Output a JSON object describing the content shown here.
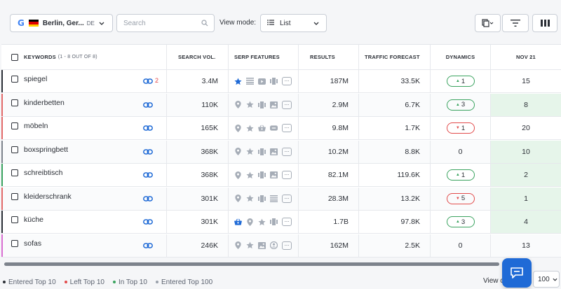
{
  "toolbar": {
    "location": "Berlin, Ger...",
    "location_code": "DE",
    "search_placeholder": "Search",
    "view_mode_label": "View mode:",
    "view_mode_value": "List"
  },
  "table": {
    "headers": {
      "keywords": "KEYWORDS",
      "keywords_count": "(1 - 8 OUT OF 8)",
      "search_vol": "SEARCH VOL.",
      "serp_features": "SERP FEATURES",
      "results": "RESULTS",
      "traffic_forecast": "TRAFFIC FORECAST",
      "dynamics": "DYNAMICS",
      "nov": "NOV 21"
    },
    "rows": [
      {
        "keyword": "spiegel",
        "links": "2",
        "indicator": "#2b2f36",
        "volume": "3.4M",
        "serp": [
          "star-icon",
          "list-icon",
          "video-icon",
          "carousel-icon"
        ],
        "serp_active": 0,
        "results": "187M",
        "traffic": "33.5K",
        "dyn": "1",
        "dyn_dir": "up",
        "nov": "15",
        "nov_green": false
      },
      {
        "keyword": "kinderbetten",
        "links": "",
        "indicator": "#e26a6a",
        "volume": "110K",
        "serp": [
          "map-pin-icon",
          "star-icon",
          "carousel-icon",
          "image-icon"
        ],
        "serp_active": -1,
        "results": "2.9M",
        "traffic": "6.7K",
        "dyn": "3",
        "dyn_dir": "up",
        "nov": "8",
        "nov_green": true
      },
      {
        "keyword": "möbeln",
        "links": "",
        "indicator": "#e26a6a",
        "volume": "165K",
        "serp": [
          "map-pin-icon",
          "star-icon",
          "shopping-basket-icon",
          "sitelinks-icon"
        ],
        "serp_active": -1,
        "results": "9.8M",
        "traffic": "1.7K",
        "dyn": "1",
        "dyn_dir": "down",
        "nov": "20",
        "nov_green": false
      },
      {
        "keyword": "boxspringbett",
        "links": "",
        "indicator": "#7d838c",
        "volume": "368K",
        "serp": [
          "map-pin-icon",
          "star-icon",
          "carousel-icon",
          "image-icon"
        ],
        "serp_active": -1,
        "results": "10.2M",
        "traffic": "8.8K",
        "dyn": "0",
        "dyn_dir": "none",
        "nov": "10",
        "nov_green": true
      },
      {
        "keyword": "schreibtisch",
        "links": "",
        "indicator": "#3aa35f",
        "volume": "368K",
        "serp": [
          "map-pin-icon",
          "star-icon",
          "carousel-icon",
          "image-icon"
        ],
        "serp_active": -1,
        "results": "82.1M",
        "traffic": "119.6K",
        "dyn": "1",
        "dyn_dir": "up",
        "nov": "2",
        "nov_green": true
      },
      {
        "keyword": "kleiderschrank",
        "links": "",
        "indicator": "#e26a6a",
        "volume": "301K",
        "serp": [
          "map-pin-icon",
          "star-icon",
          "carousel-icon",
          "list-icon"
        ],
        "serp_active": -1,
        "results": "28.3M",
        "traffic": "13.2K",
        "dyn": "5",
        "dyn_dir": "down",
        "nov": "1",
        "nov_green": true
      },
      {
        "keyword": "küche",
        "links": "",
        "indicator": "#2b2f36",
        "volume": "301K",
        "serp": [
          "shopping-basket-icon",
          "map-pin-icon",
          "star-icon",
          "carousel-icon"
        ],
        "serp_active": 0,
        "results": "1.7B",
        "traffic": "97.8K",
        "dyn": "3",
        "dyn_dir": "up",
        "nov": "4",
        "nov_green": true
      },
      {
        "keyword": "sofas",
        "links": "",
        "indicator": "#d86fd1",
        "volume": "246K",
        "serp": [
          "map-pin-icon",
          "star-icon",
          "image-icon",
          "review-icon"
        ],
        "serp_active": -1,
        "results": "162M",
        "traffic": "2.5K",
        "dyn": "0",
        "dyn_dir": "none",
        "nov": "13",
        "nov_green": false
      }
    ]
  },
  "footer": {
    "legend": [
      {
        "label": "Entered Top 10",
        "color": "#2b2f36"
      },
      {
        "label": "Left Top 10",
        "color": "#e24b4b"
      },
      {
        "label": "In Top 10",
        "color": "#3aa35f"
      },
      {
        "label": "Entered Top 100",
        "color": "#9aa1ab"
      }
    ],
    "view_label": "View c",
    "per_page": "100"
  },
  "colors": {
    "accent": "#1f6ad6",
    "green": "#3aa35f",
    "red": "#e24b4b"
  }
}
